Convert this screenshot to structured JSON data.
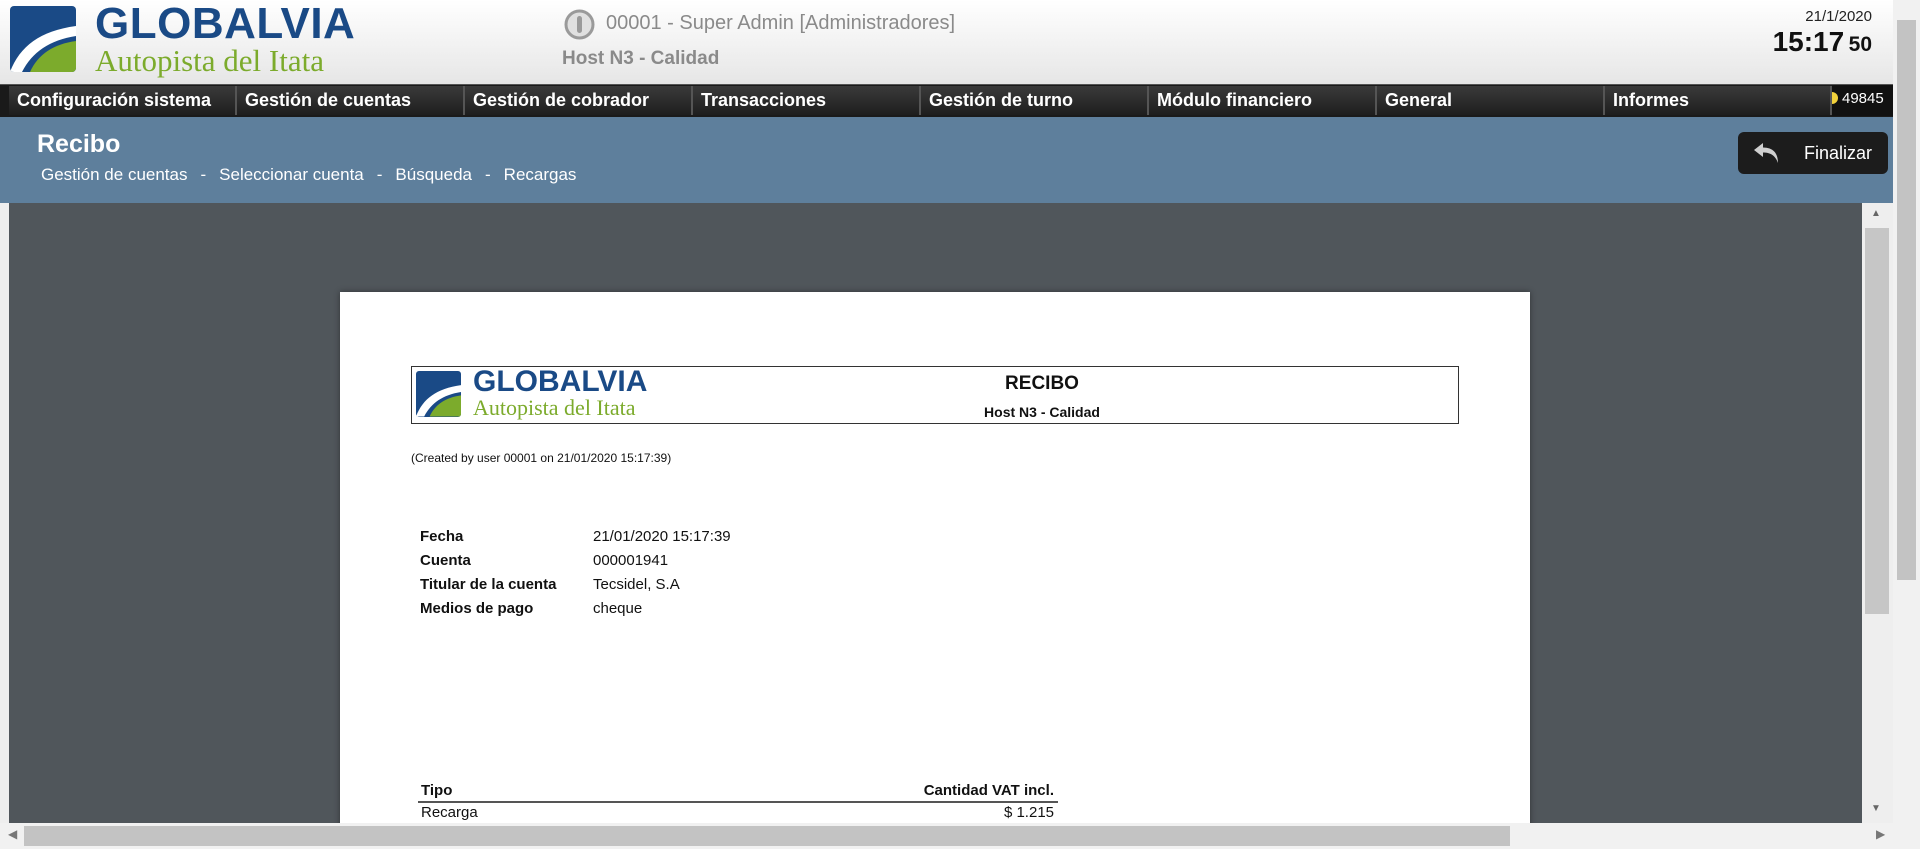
{
  "header": {
    "logo": {
      "brand": "GLOBALVIA",
      "sub": "Autopista del Itata",
      "icon": "globalvia-logo-icon"
    },
    "user": "00001 - Super Admin [Administradores]",
    "host": "Host N3 - Calidad",
    "date": "21/1/2020",
    "time_hm": "15:17",
    "time_sec": "50"
  },
  "menu": {
    "items": [
      {
        "label": "Configuración sistema"
      },
      {
        "label": "Gestión de cuentas"
      },
      {
        "label": "Gestión de cobrador"
      },
      {
        "label": "Transacciones"
      },
      {
        "label": "Gestión de turno"
      },
      {
        "label": "Módulo financiero"
      },
      {
        "label": "General"
      },
      {
        "label": "Informes"
      }
    ],
    "count": "49845"
  },
  "subheader": {
    "title": "Recibo",
    "breadcrumb": [
      "Gestión de cuentas",
      "Seleccionar cuenta",
      "Búsqueda",
      "Recargas"
    ],
    "separator": "-",
    "finalizar_label": "Finalizar"
  },
  "document": {
    "logo": {
      "brand": "GLOBALVIA",
      "sub": "Autopista del Itata"
    },
    "title": "RECIBO",
    "host": "Host N3 - Calidad",
    "created": "(Created by user 00001 on 21/01/2020 15:17:39)",
    "details": [
      {
        "key": "Fecha",
        "value": "21/01/2020 15:17:39"
      },
      {
        "key": "Cuenta",
        "value": "000001941"
      },
      {
        "key": "Titular de la cuenta",
        "value": "Tecsidel, S.A"
      },
      {
        "key": "Medios de pago",
        "value": "cheque"
      }
    ],
    "table": {
      "headers": [
        "Tipo",
        "Cantidad VAT incl."
      ],
      "rows": [
        [
          "Recarga",
          "$ 1.215"
        ]
      ]
    }
  },
  "colors": {
    "brand_blue": "#1a4a86",
    "brand_green": "#7cab2c",
    "subheader_bg": "#5e7f9c",
    "viewer_bg": "#50565b"
  }
}
